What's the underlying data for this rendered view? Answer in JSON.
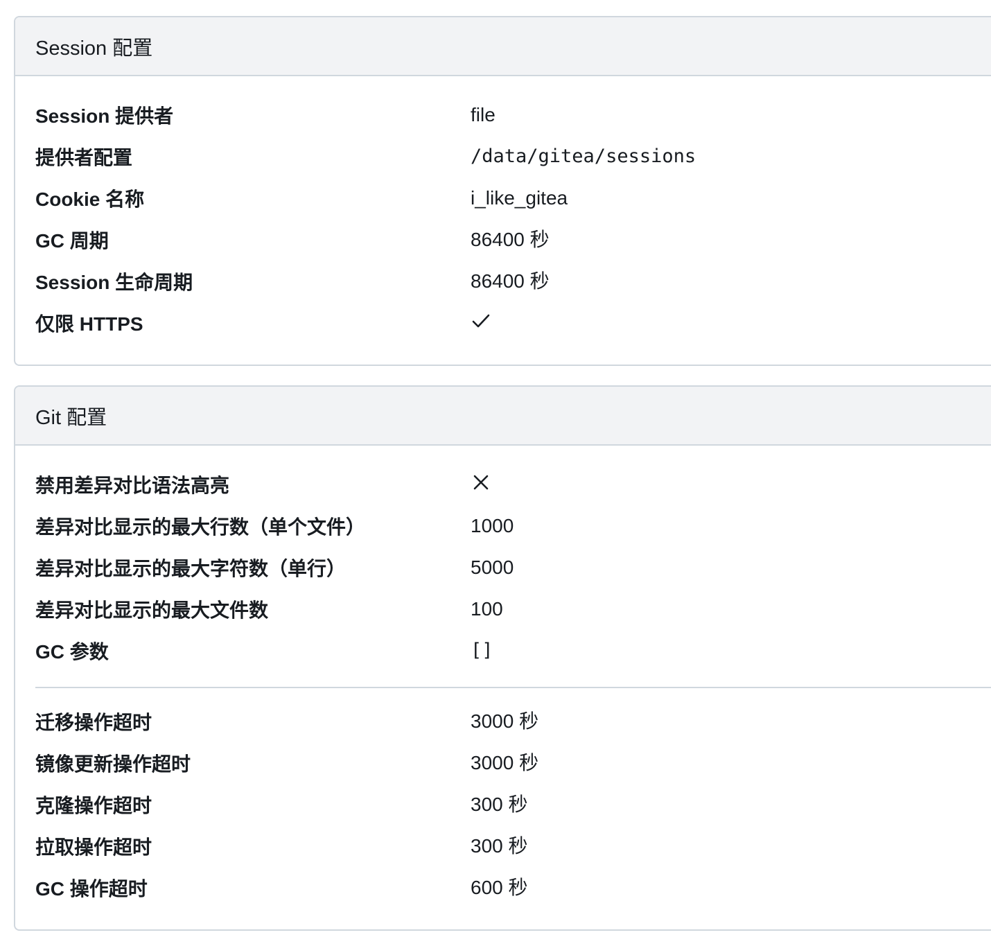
{
  "session": {
    "title": "Session 配置",
    "rows": [
      {
        "label": "Session 提供者",
        "value": "file"
      },
      {
        "label": "提供者配置",
        "value": "/data/gitea/sessions"
      },
      {
        "label": "Cookie 名称",
        "value": "i_like_gitea"
      },
      {
        "label": "GC 周期",
        "value": "86400 秒"
      },
      {
        "label": "Session 生命周期",
        "value": "86400 秒"
      },
      {
        "label": "仅限 HTTPS",
        "icon": "check-icon"
      }
    ]
  },
  "git": {
    "title": "Git 配置",
    "rows": [
      {
        "label": "禁用差异对比语法高亮",
        "icon": "cross-icon"
      },
      {
        "label": "差异对比显示的最大行数（单个文件）",
        "value": "1000"
      },
      {
        "label": "差异对比显示的最大字符数（单行）",
        "value": "5000"
      },
      {
        "label": "差异对比显示的最大文件数",
        "value": "100"
      },
      {
        "label": "GC 参数",
        "value": "[]"
      }
    ],
    "timeout_rows": [
      {
        "label": "迁移操作超时",
        "value": "3000 秒"
      },
      {
        "label": "镜像更新操作超时",
        "value": "3000 秒"
      },
      {
        "label": "克隆操作超时",
        "value": "300 秒"
      },
      {
        "label": "拉取操作超时",
        "value": "300 秒"
      },
      {
        "label": "GC 操作超时",
        "value": "600 秒"
      }
    ]
  }
}
